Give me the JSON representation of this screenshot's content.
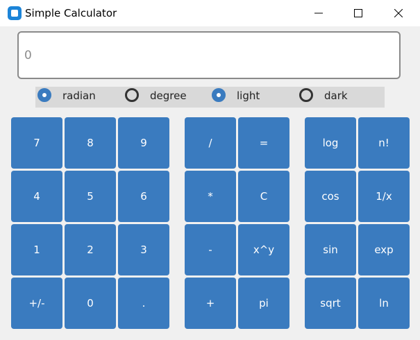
{
  "window": {
    "title": "Simple Calculator",
    "accent": "#3a7bbf"
  },
  "display": {
    "value": "0"
  },
  "radios": [
    {
      "label": "radian",
      "checked": true
    },
    {
      "label": "degree",
      "checked": false
    },
    {
      "label": "light",
      "checked": true
    },
    {
      "label": "dark",
      "checked": false
    }
  ],
  "keypad": {
    "digits": [
      "7",
      "8",
      "9",
      "4",
      "5",
      "6",
      "1",
      "2",
      "3",
      "+/-",
      "0",
      "."
    ],
    "operators": [
      "/",
      "=",
      "*",
      "C",
      "-",
      "x^y",
      "+",
      "pi"
    ],
    "functions": [
      "log",
      "n!",
      "cos",
      "1/x",
      "sin",
      "exp",
      "sqrt",
      "ln"
    ]
  }
}
